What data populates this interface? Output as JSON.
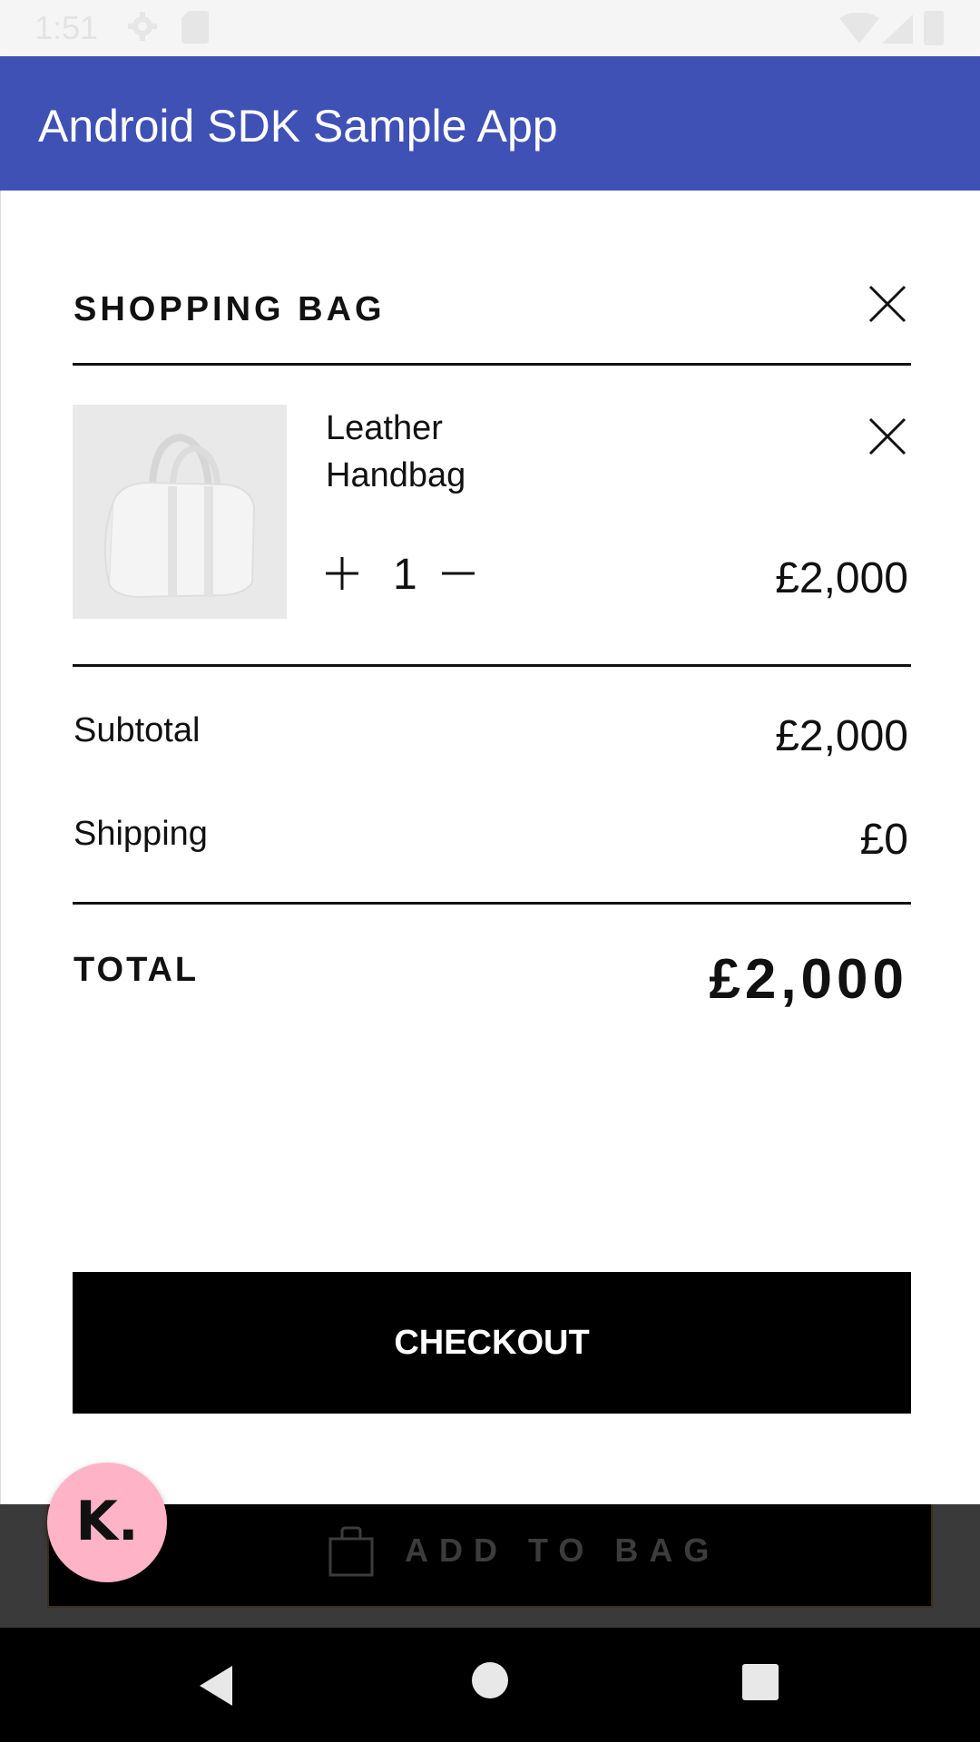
{
  "status_bar": {
    "time": "1:51",
    "icons": [
      "gear-icon",
      "sd-card-icon",
      "wifi-icon",
      "signal-icon",
      "battery-icon"
    ]
  },
  "app_bar": {
    "title": "Android SDK Sample App",
    "color": "#3f51b5"
  },
  "bag": {
    "title": "SHOPPING BAG",
    "close_icon": "close-icon",
    "item": {
      "name": "Leather Handbag",
      "image": "leather-handbag-image",
      "quantity": "1",
      "price": "£2,000",
      "plus_icon": "plus-icon",
      "minus_icon": "minus-icon",
      "remove_icon": "close-icon"
    },
    "subtotal": {
      "label": "Subtotal",
      "value": "£2,000"
    },
    "shipping": {
      "label": "Shipping",
      "value": "£0"
    },
    "total": {
      "label": "TOTAL",
      "value": "£2,000"
    },
    "checkout_label": "CHECKOUT"
  },
  "background_page": {
    "add_to_bag_label": "ADD TO BAG",
    "bag_icon": "shopping-bag-icon"
  },
  "klarna_badge": {
    "logo_text": "K.",
    "color": "#ffb3c7"
  },
  "nav_bar": {
    "icons": [
      "back-icon",
      "home-icon",
      "recents-icon"
    ]
  }
}
